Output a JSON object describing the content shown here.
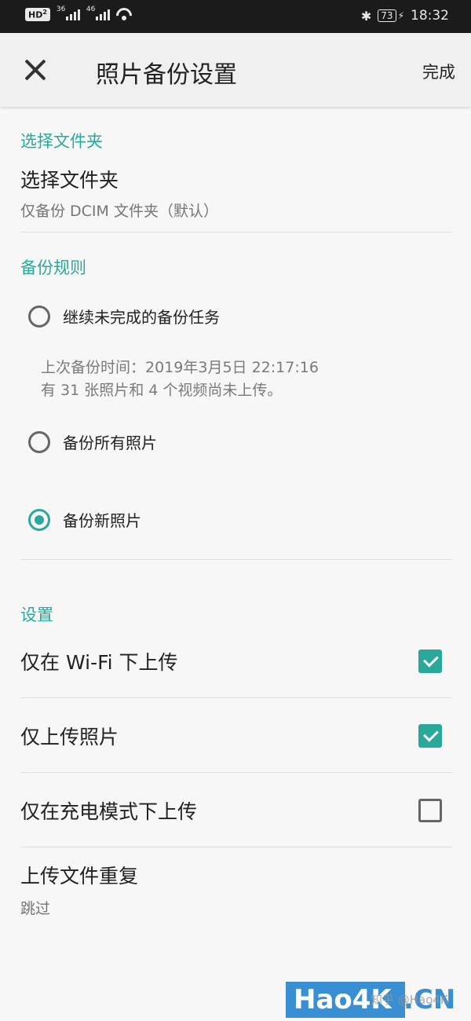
{
  "status_bar": {
    "hd": "HD",
    "hd_sub": "2",
    "sim1": "36",
    "sim2": "46",
    "battery": "73",
    "time": "18:32"
  },
  "app_bar": {
    "title": "照片备份设置",
    "done_label": "完成"
  },
  "folder_section": {
    "header": "选择文件夹",
    "title": "选择文件夹",
    "subtitle": "仅备份 DCIM 文件夹（默认）"
  },
  "rules_section": {
    "header": "备份规则",
    "options": [
      {
        "label": "继续未完成的备份任务",
        "selected": false
      },
      {
        "label": "备份所有照片",
        "selected": false
      },
      {
        "label": "备份新照片",
        "selected": true
      }
    ],
    "note_line1": "上次备份时间：2019年3月5日 22:17:16",
    "note_line2": "有 31 张照片和 4 个视频尚未上传。"
  },
  "settings_section": {
    "header": "设置",
    "items": [
      {
        "label": "仅在 Wi-Fi 下上传",
        "checked": true
      },
      {
        "label": "仅上传照片",
        "checked": true
      },
      {
        "label": "仅在充电模式下上传",
        "checked": false
      }
    ],
    "duplicate_title": "上传文件重复",
    "duplicate_value": "跳过"
  },
  "watermark": {
    "brand": "Hao4K",
    "tld": ".CN",
    "credit": "知乎 @Hao4K"
  },
  "colors": {
    "accent": "#2aa89a",
    "status_bar": "#1b1b1b",
    "background": "#f7f7f7"
  }
}
